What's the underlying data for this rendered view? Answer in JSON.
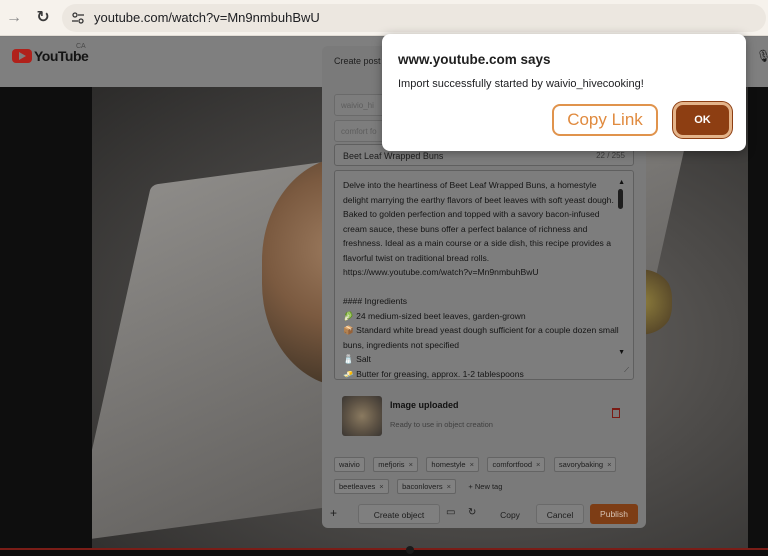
{
  "browser": {
    "url": "youtube.com/watch?v=Mn9nmbuhBwU"
  },
  "youtube": {
    "logo_text": "YouTube",
    "country": "CA"
  },
  "modal": {
    "title": "Create post",
    "field1_placeholder": "waivio_hi",
    "field2_placeholder": "comfort fo",
    "post_title": "Beet Leaf Wrapped Buns",
    "title_count": "22 / 255",
    "description": "Delve into the heartiness of Beet Leaf Wrapped Buns, a homestyle delight marrying the earthy flavors of beet leaves with soft yeast dough. Baked to golden perfection and topped with a savory bacon-infused cream sauce, these buns offer a perfect balance of richness and freshness. Ideal as a main course or a side dish, this recipe provides a flavorful twist on traditional bread rolls.\nhttps://www.youtube.com/watch?v=Mn9nmbuhBwU\n\n#### Ingredients\n🥬 24 medium-sized beet leaves, garden-grown\n📦 Standard white bread yeast dough sufficient for a couple dozen small buns, ingredients not specified\n🧂 Salt\n🧈 Butter for greasing, approx. 1-2 tablespoons",
    "upload_title": "Image uploaded",
    "upload_subtitle": "Ready to use in object creation",
    "tags": [
      "waivio",
      "mefjoris",
      "homestyle",
      "comfortfood",
      "savorybaking",
      "beetleaves",
      "baconlovers"
    ],
    "new_tag_label": "+ New tag",
    "footer": {
      "plus": "+",
      "create_object": "Create object",
      "copy": "Copy",
      "cancel": "Cancel",
      "publish": "Publish"
    }
  },
  "alert": {
    "title": "www.youtube.com says",
    "message": "Import successfully started by waivio_hivecooking!",
    "copy_link_label": "Copy Link",
    "ok_label": "OK"
  }
}
